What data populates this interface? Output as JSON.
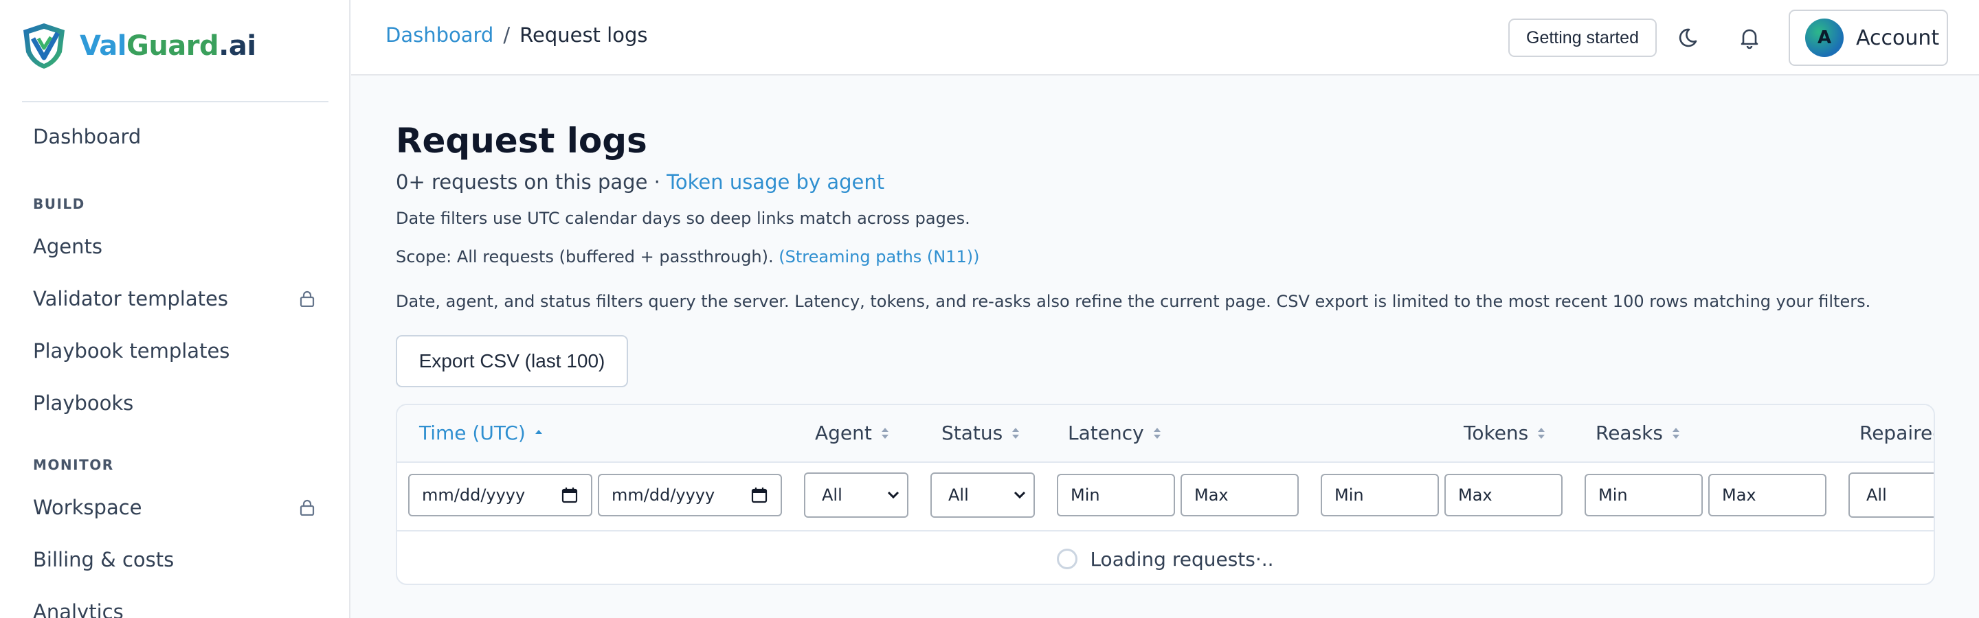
{
  "brand": {
    "part1": "Val",
    "part2": "Guard",
    "part3": ".ai"
  },
  "sidebar": {
    "dashboard": "Dashboard",
    "build_header": "BUILD",
    "build_items": [
      "Agents",
      "Validator templates",
      "Playbook templates",
      "Playbooks"
    ],
    "monitor_header": "MONITOR",
    "monitor_items": [
      "Workspace",
      "Billing & costs",
      "Analytics"
    ],
    "lock_icon": "lock-icon"
  },
  "topbar": {
    "breadcrumb_root": "Dashboard",
    "breadcrumb_sep": "/",
    "breadcrumb_current": "Request logs",
    "getting_started": "Getting started",
    "theme_icon": "moon-icon",
    "notifications_icon": "bell-icon",
    "avatar_initial": "A",
    "account_label": "Account"
  },
  "main": {
    "title": "Request logs",
    "count_text": "0+ requests on this page ·",
    "token_link": "Token usage by agent",
    "date_note": "Date filters use UTC calendar days so deep links match across pages.",
    "scope_text": "Scope: All requests (buffered + passthrough).",
    "scope_link": "(Streaming paths (N11))",
    "filter_note": "Date, agent, and status filters query the server. Latency, tokens, and re-asks also refine the current page. CSV export is limited to the most recent 100 rows matching your filters.",
    "export_button": "Export CSV (last 100)"
  },
  "table": {
    "columns": [
      "Time (UTC)",
      "Agent",
      "Status",
      "Latency",
      "Tokens",
      "Reasks",
      "Repaired"
    ],
    "active_sort": "Time (UTC)",
    "filters": {
      "date_placeholder": "mm/dd/yyyy",
      "select_value": "All",
      "min_placeholder": "Min",
      "max_placeholder": "Max"
    },
    "loading_text": "Loading requests·.."
  },
  "colors": {
    "accent": "#2f8fd0",
    "logo_blue": "#2f9ad8",
    "logo_green": "#3aa05c",
    "logo_navy": "#1f3b5c"
  }
}
